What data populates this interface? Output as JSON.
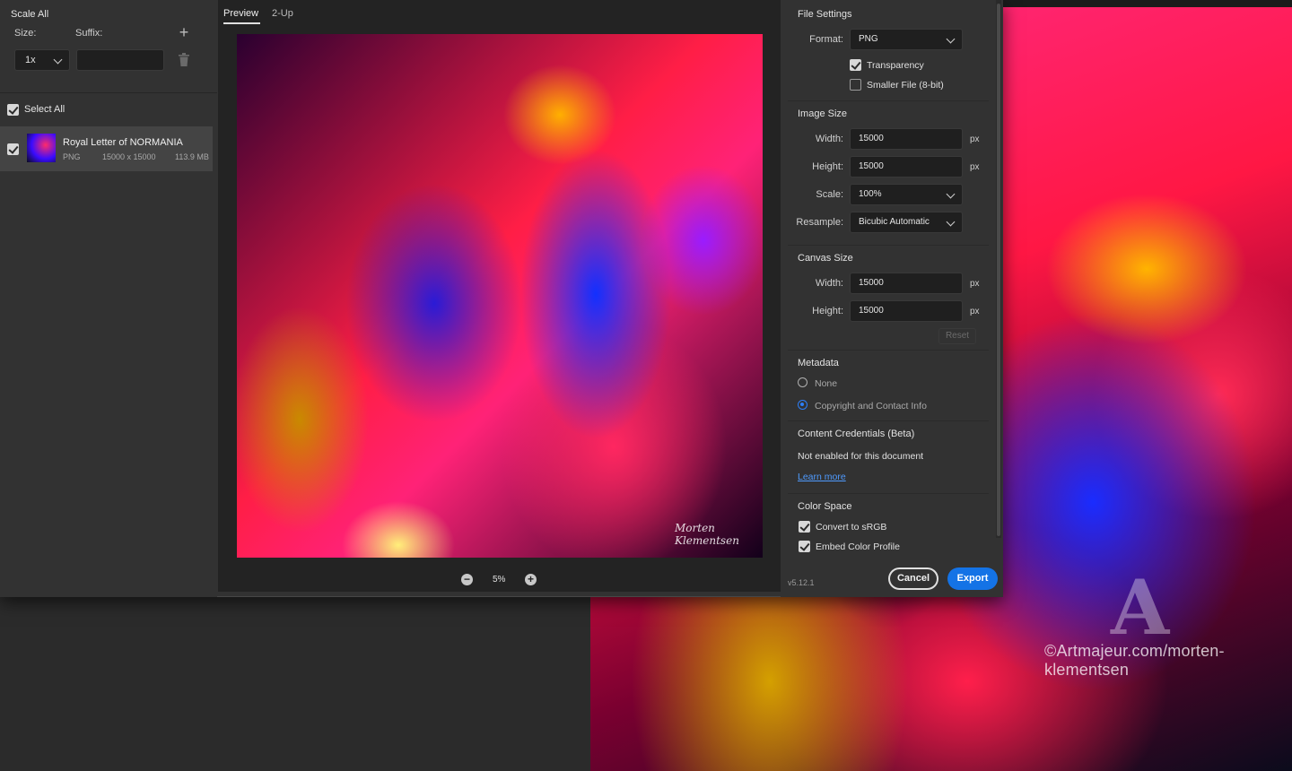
{
  "left_panel": {
    "scale_all": "Scale All",
    "size_label": "Size:",
    "suffix_label": "Suffix:",
    "scale_value": "1x",
    "suffix_value": "",
    "select_all": "Select All",
    "asset": {
      "name": "Royal Letter of NORMANIA",
      "format": "PNG",
      "dimensions": "15000 x 15000",
      "filesize": "113.9 MB"
    }
  },
  "preview": {
    "tabs": [
      "Preview",
      "2-Up"
    ],
    "active_tab": "Preview",
    "signature": "Morten Klementsen",
    "zoom": "5%"
  },
  "settings": {
    "file_settings": {
      "title": "File Settings",
      "format_label": "Format:",
      "format_value": "PNG",
      "transparency_label": "Transparency",
      "transparency_checked": true,
      "smaller_file_label": "Smaller File (8-bit)",
      "smaller_file_checked": false
    },
    "image_size": {
      "title": "Image Size",
      "width_label": "Width:",
      "width_value": "15000",
      "height_label": "Height:",
      "height_value": "15000",
      "scale_label": "Scale:",
      "scale_value": "100%",
      "resample_label": "Resample:",
      "resample_value": "Bicubic Automatic",
      "unit": "px"
    },
    "canvas_size": {
      "title": "Canvas Size",
      "width_label": "Width:",
      "width_value": "15000",
      "height_label": "Height:",
      "height_value": "15000",
      "unit": "px",
      "reset_label": "Reset"
    },
    "metadata": {
      "title": "Metadata",
      "options": [
        "None",
        "Copyright and Contact Info"
      ],
      "selected": "Copyright and Contact Info"
    },
    "content_credentials": {
      "title": "Content Credentials (Beta)",
      "status": "Not enabled for this document",
      "link": "Learn more"
    },
    "color_space": {
      "title": "Color Space",
      "convert_label": "Convert to sRGB",
      "convert_checked": true,
      "embed_label": "Embed Color Profile",
      "embed_checked": true
    },
    "version": "v5.12.1",
    "cancel_label": "Cancel",
    "export_label": "Export"
  },
  "background": {
    "watermark": "©Artmajeur.com/morten-klementsen"
  },
  "colors": {
    "accent": "#1473e6",
    "radio_selected": "#2d7ff9",
    "panel_bg": "#323232",
    "preview_bg": "#232323"
  }
}
